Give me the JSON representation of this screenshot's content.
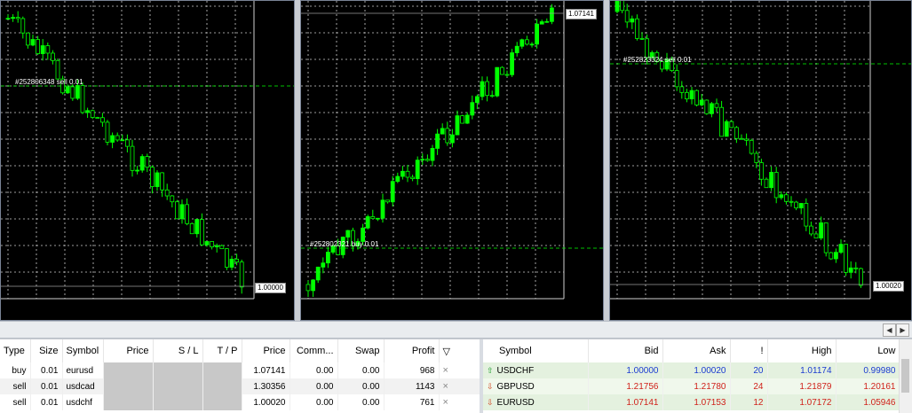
{
  "charts": [
    {
      "id": "chart1",
      "current_price": "1.00000",
      "order_label": "#252806348 sell 0.01",
      "candle_color": "#00ff00",
      "trend": "down"
    },
    {
      "id": "chart2",
      "current_price": "1.07141",
      "order_label": "#252802321 buy 0.01",
      "candle_color": "#00ff00",
      "trend": "up"
    },
    {
      "id": "chart3",
      "current_price": "1.00020",
      "order_label": "#252823324 sell 0.01",
      "candle_color": "#00ff00",
      "trend": "down"
    }
  ],
  "scroll": {
    "left_arrow": "◀",
    "right_arrow": "▶"
  },
  "trade": {
    "headers": [
      "Type",
      "Size",
      "Symbol",
      "Price",
      "S / L",
      "T / P",
      "Price",
      "Comm...",
      "Swap",
      "Profit"
    ],
    "sort_icon": "▽",
    "close_glyph": "×",
    "rows": [
      {
        "type": "buy",
        "size": "0.01",
        "symbol": "eurusd",
        "cur_price": "1.07141",
        "comm": "0.00",
        "swap": "0.00",
        "profit": "968"
      },
      {
        "type": "sell",
        "size": "0.01",
        "symbol": "usdcad",
        "cur_price": "1.30356",
        "comm": "0.00",
        "swap": "0.00",
        "profit": "1143"
      },
      {
        "type": "sell",
        "size": "0.01",
        "symbol": "usdchf",
        "cur_price": "1.00020",
        "comm": "0.00",
        "swap": "0.00",
        "profit": "761"
      }
    ]
  },
  "market_watch": {
    "headers": [
      "Symbol",
      "Bid",
      "Ask",
      "!",
      "High",
      "Low"
    ],
    "colors": {
      "up": "#1a3bd0",
      "down": "#d0211a"
    },
    "rows": [
      {
        "symbol": "USDCHF",
        "dir": "up",
        "bid": "1.00000",
        "ask": "1.00020",
        "spread": "20",
        "high": "1.01174",
        "low": "0.99980"
      },
      {
        "symbol": "GBPUSD",
        "dir": "down",
        "bid": "1.21756",
        "ask": "1.21780",
        "spread": "24",
        "high": "1.21879",
        "low": "1.20161"
      },
      {
        "symbol": "EURUSD",
        "dir": "down",
        "bid": "1.07141",
        "ask": "1.07153",
        "spread": "12",
        "high": "1.07172",
        "low": "1.05946"
      }
    ]
  }
}
